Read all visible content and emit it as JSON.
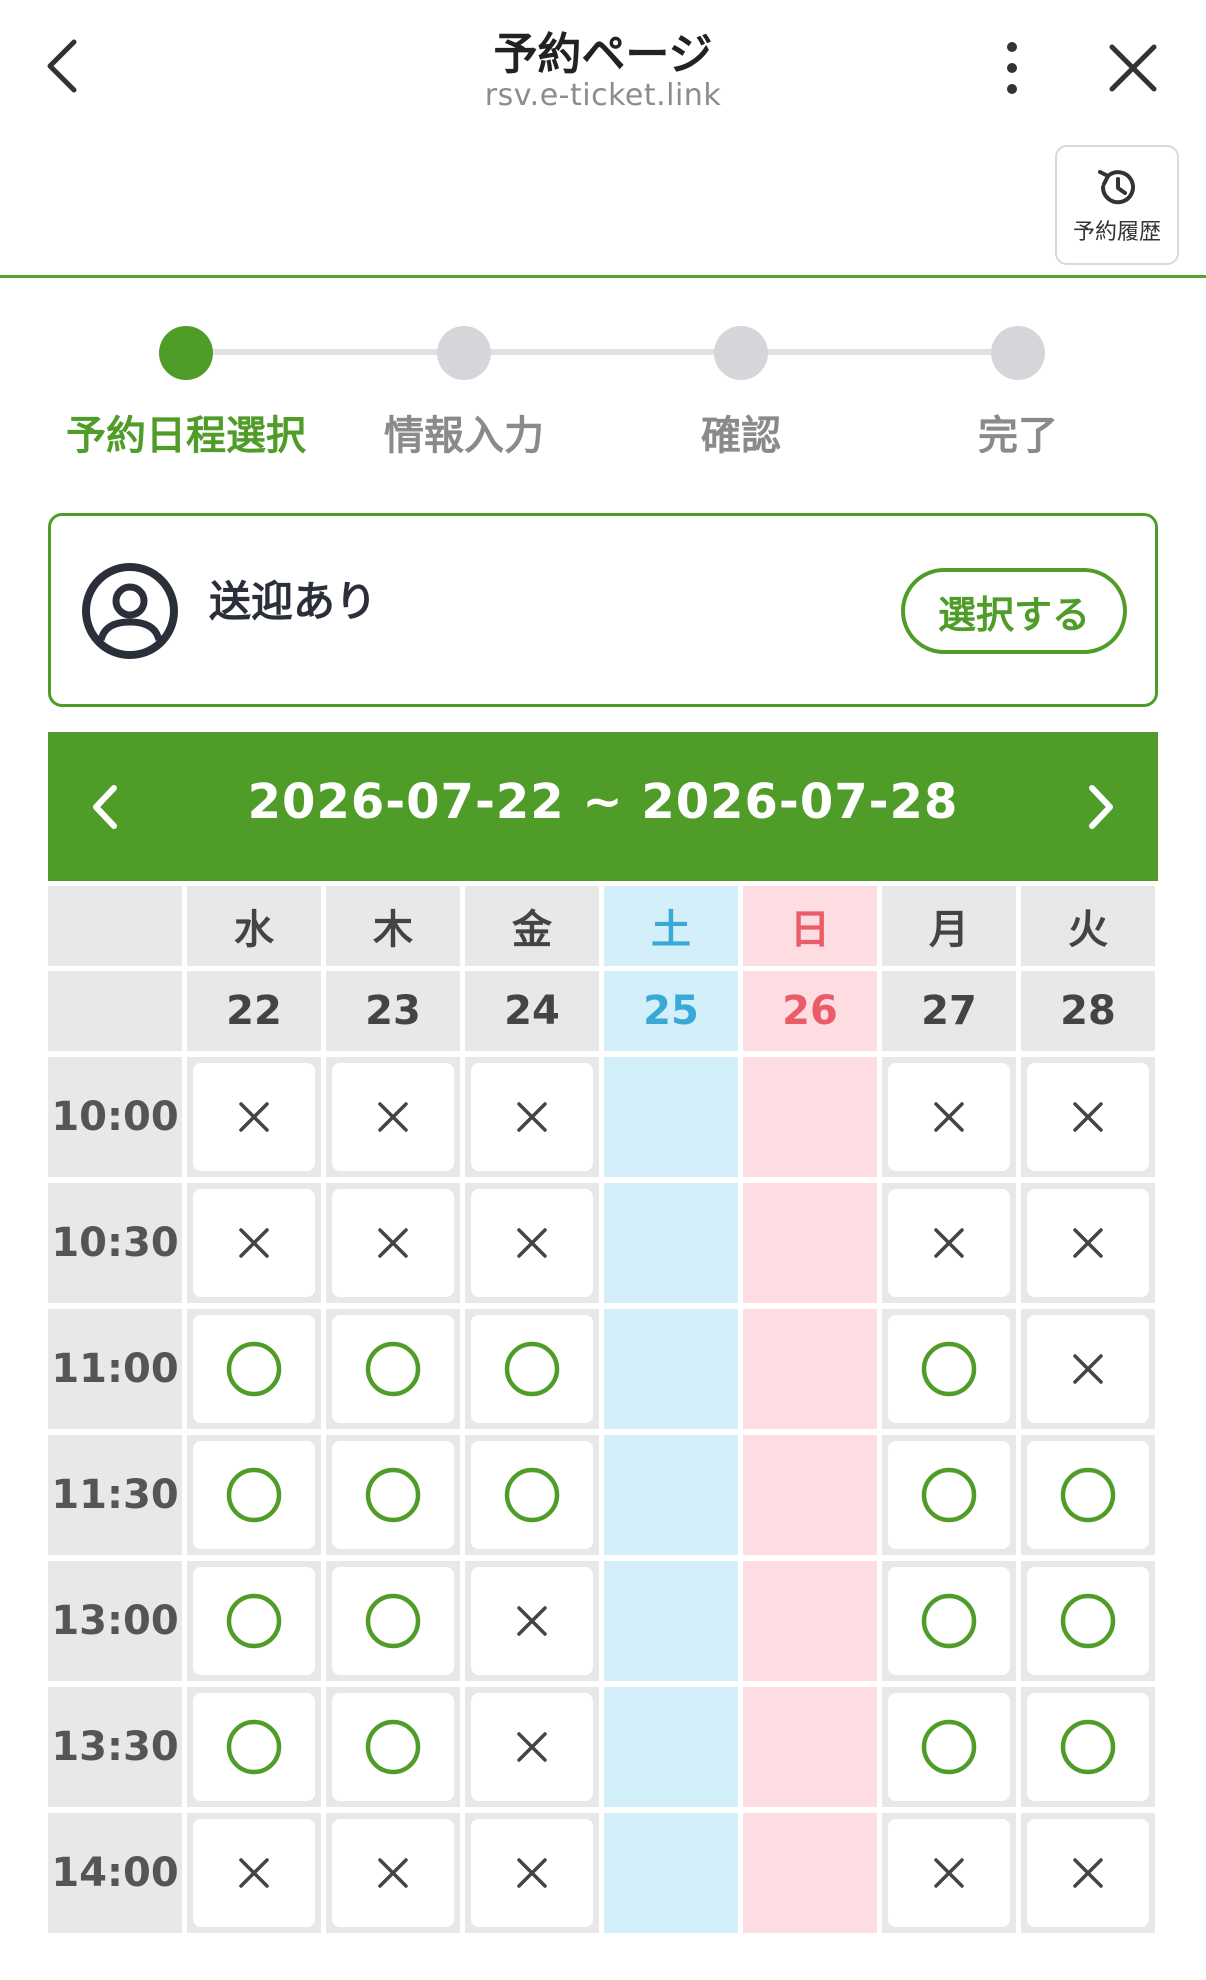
{
  "header": {
    "title": "予約ページ",
    "url": "rsv.e-ticket.link",
    "history_label": "予約履歴"
  },
  "steps": [
    {
      "label": "予約日程選択",
      "active": true
    },
    {
      "label": "情報入力",
      "active": false
    },
    {
      "label": "確認",
      "active": false
    },
    {
      "label": "完了",
      "active": false
    }
  ],
  "option": {
    "label": "送迎あり",
    "button": "選択する"
  },
  "week": {
    "range": "2026-07-22 ~ 2026-07-28"
  },
  "calendar": {
    "days": [
      {
        "weekday": "水",
        "date": "22",
        "type": "weekday"
      },
      {
        "weekday": "木",
        "date": "23",
        "type": "weekday"
      },
      {
        "weekday": "金",
        "date": "24",
        "type": "weekday"
      },
      {
        "weekday": "土",
        "date": "25",
        "type": "saturday"
      },
      {
        "weekday": "日",
        "date": "26",
        "type": "sunday"
      },
      {
        "weekday": "月",
        "date": "27",
        "type": "weekday"
      },
      {
        "weekday": "火",
        "date": "28",
        "type": "weekday"
      }
    ],
    "times": [
      "10:00",
      "10:30",
      "11:00",
      "11:30",
      "13:00",
      "13:30",
      "14:00"
    ],
    "slots": [
      [
        "x",
        "x",
        "x",
        "",
        "",
        "x",
        "x"
      ],
      [
        "x",
        "x",
        "x",
        "",
        "",
        "x",
        "x"
      ],
      [
        "o",
        "o",
        "o",
        "",
        "",
        "o",
        "x"
      ],
      [
        "o",
        "o",
        "o",
        "",
        "",
        "o",
        "o"
      ],
      [
        "o",
        "o",
        "x",
        "",
        "",
        "o",
        "o"
      ],
      [
        "o",
        "o",
        "x",
        "",
        "",
        "o",
        "o"
      ],
      [
        "x",
        "x",
        "x",
        "",
        "",
        "x",
        "x"
      ]
    ]
  },
  "colors": {
    "brand": "#4f9c28",
    "saturday": "#3aa9d6",
    "sunday": "#ea5c68"
  }
}
